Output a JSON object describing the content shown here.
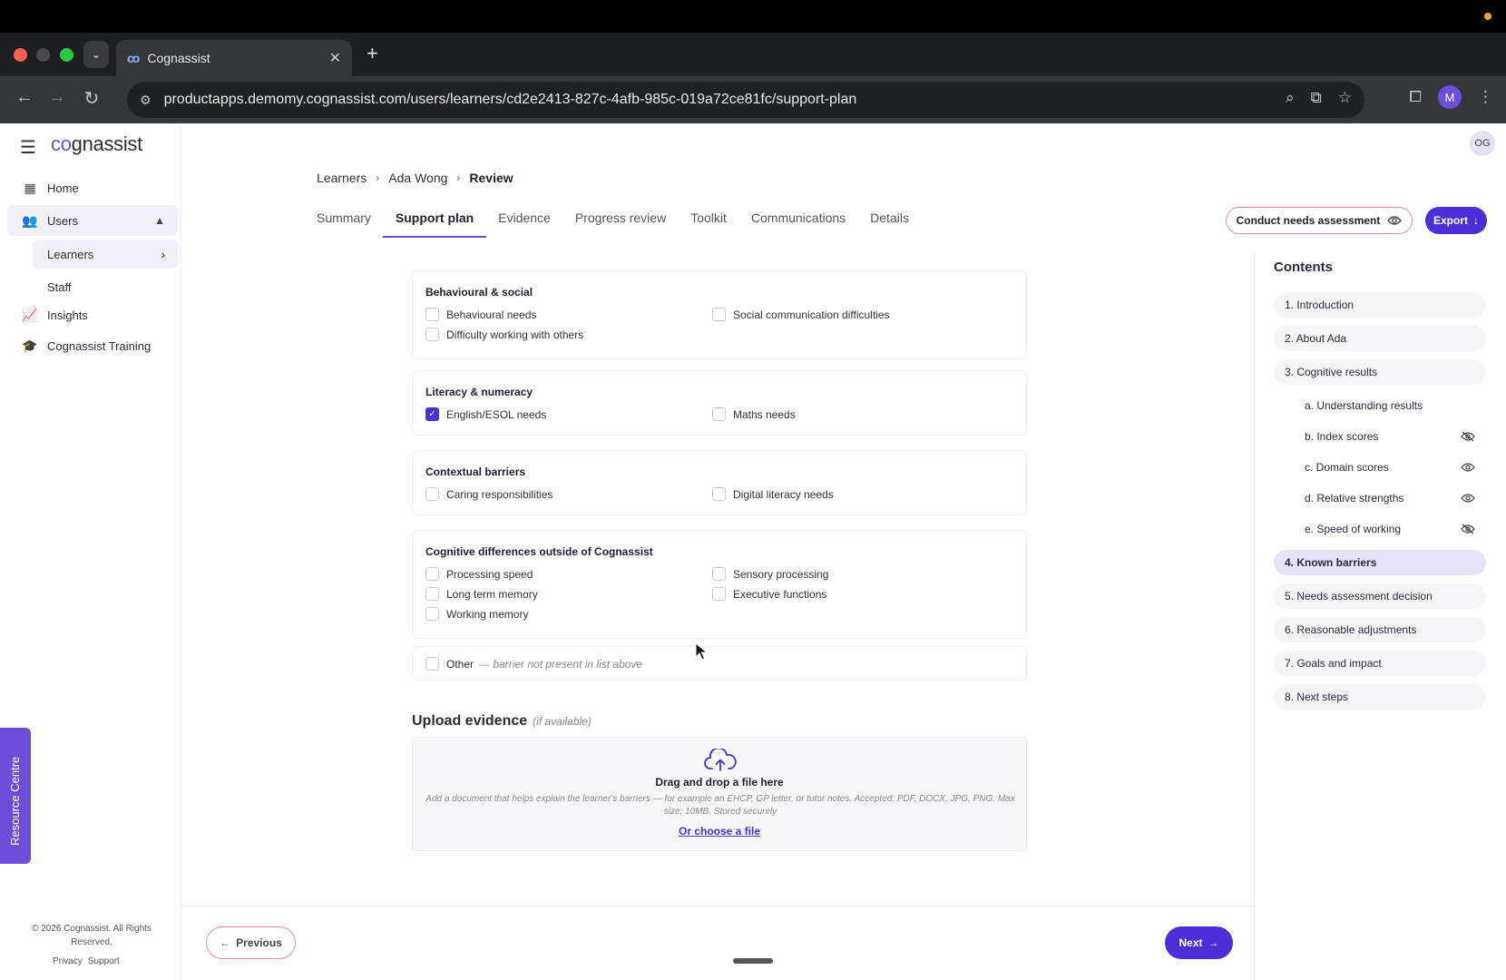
{
  "browser": {
    "tab_title": "Cognassist",
    "url": "productapps.demomy.cognassist.com/users/learners/cd2e2413-827c-4afb-985c-019a72ce81fc/support-plan",
    "profile_initial": "M"
  },
  "app": {
    "logo_co": "co",
    "logo_rest": "gnassist",
    "user_initials": "OG"
  },
  "sidebar": {
    "home": "Home",
    "users": "Users",
    "learners": "Learners",
    "staff": "Staff",
    "insights": "Insights",
    "training": "Cognassist Training",
    "resource_centre": "Resource Centre",
    "copyright": "© 2026 Cognassist. All Rights Reserved.",
    "privacy": "Privacy",
    "support": "Support"
  },
  "breadcrumb": {
    "learners": "Learners",
    "name": "Ada Wong",
    "current": "Review"
  },
  "tabs": [
    "Summary",
    "Support plan",
    "Evidence",
    "Progress review",
    "Toolkit",
    "Communications",
    "Details"
  ],
  "actions": {
    "conduct": "Conduct needs assessment",
    "export": "Export"
  },
  "barriers": {
    "behavioural": {
      "title": "Behavioural & social",
      "items": [
        "Behavioural needs",
        "Social communication difficulties",
        "Difficulty working with others"
      ],
      "checked": [
        false,
        false,
        false
      ]
    },
    "literacy": {
      "title": "Literacy & numeracy",
      "items": [
        "English/ESOL needs",
        "Maths needs"
      ],
      "checked": [
        true,
        false
      ]
    },
    "contextual": {
      "title": "Contextual barriers",
      "items": [
        "Caring responsibilities",
        "Digital literacy needs"
      ],
      "checked": [
        false,
        false
      ]
    },
    "cognitive": {
      "title": "Cognitive differences outside of Cognassist",
      "items": [
        "Processing speed",
        "Sensory processing",
        "Long term memory",
        "Executive functions",
        "Working memory"
      ],
      "checked": [
        false,
        false,
        false,
        false,
        false
      ]
    },
    "other": {
      "label": "Other",
      "hint": "— barrier not present in list above",
      "checked": false
    }
  },
  "upload": {
    "title": "Upload evidence",
    "optional": "(if available)",
    "drop_title": "Drag and drop a file here",
    "description": "Add a document that helps explain the learner's barriers — for example an EHCP, GP letter, or tutor notes. Accepted: PDF, DOCX, JPG, PNG. Max size: 10MB. Stored securely",
    "choose": "Or choose a file"
  },
  "footer": {
    "previous": "Previous",
    "next": "Next"
  },
  "contents": {
    "title": "Contents",
    "items": [
      "1. Introduction",
      "2. About Ada",
      "3. Cognitive results",
      "a. Understanding results",
      "b. Index scores",
      "c. Domain scores",
      "d. Relative strengths",
      "e. Speed of working",
      "4. Known barriers",
      "5. Needs assessment decision",
      "6. Reasonable adjustments",
      "7. Goals and impact",
      "8. Next steps"
    ]
  },
  "colors": {
    "accent": "#4c2ed8",
    "pink_outline": "#e58bb3",
    "active_bg": "#e6e2f7"
  }
}
